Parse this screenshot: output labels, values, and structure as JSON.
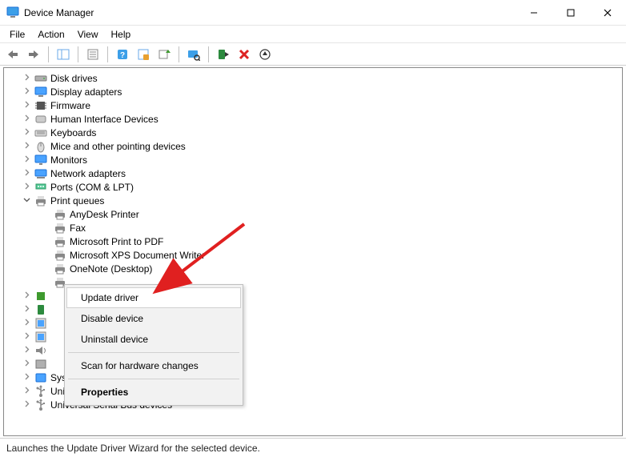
{
  "window": {
    "title": "Device Manager",
    "minimize": "–",
    "maximize": "□",
    "close": "✕"
  },
  "menu": {
    "file": "File",
    "action": "Action",
    "view": "View",
    "help": "Help"
  },
  "toolbar": {
    "back": "back",
    "forward": "forward",
    "show_hide": "show-hide",
    "properties": "properties",
    "help": "help",
    "refresh": "refresh",
    "uninstall": "uninstall",
    "update": "update",
    "scan": "scan",
    "disable": "disable",
    "remove": "remove",
    "more": "more"
  },
  "tree": {
    "items": [
      {
        "label": "Disk drives",
        "expanded": false,
        "icon": "disk"
      },
      {
        "label": "Display adapters",
        "expanded": false,
        "icon": "display"
      },
      {
        "label": "Firmware",
        "expanded": false,
        "icon": "chip"
      },
      {
        "label": "Human Interface Devices",
        "expanded": false,
        "icon": "hid"
      },
      {
        "label": "Keyboards",
        "expanded": false,
        "icon": "keyboard"
      },
      {
        "label": "Mice and other pointing devices",
        "expanded": false,
        "icon": "mouse"
      },
      {
        "label": "Monitors",
        "expanded": false,
        "icon": "monitor"
      },
      {
        "label": "Network adapters",
        "expanded": false,
        "icon": "network"
      },
      {
        "label": "Ports (COM & LPT)",
        "expanded": false,
        "icon": "port"
      },
      {
        "label": "Print queues",
        "expanded": true,
        "icon": "printer",
        "children": [
          {
            "label": "AnyDesk Printer"
          },
          {
            "label": "Fax"
          },
          {
            "label": "Microsoft Print to PDF"
          },
          {
            "label": "Microsoft XPS Document Writer"
          },
          {
            "label": "OneNote (Desktop)"
          },
          {
            "label": ""
          }
        ]
      },
      {
        "label": "",
        "expanded": false,
        "icon": "processor",
        "obscured": true
      },
      {
        "label": "",
        "expanded": false,
        "icon": "security",
        "obscured": true
      },
      {
        "label": "",
        "expanded": false,
        "icon": "software",
        "obscured": true
      },
      {
        "label": "",
        "expanded": false,
        "icon": "software",
        "obscured": true
      },
      {
        "label": "",
        "expanded": false,
        "icon": "sound",
        "obscured": true
      },
      {
        "label": "",
        "expanded": false,
        "icon": "storage",
        "obscured": true
      },
      {
        "label": "System devices",
        "expanded": false,
        "icon": "system",
        "partial": true
      },
      {
        "label": "Universal Serial Bus controllers",
        "expanded": false,
        "icon": "usb"
      },
      {
        "label": "Universal Serial Bus devices",
        "expanded": false,
        "icon": "usb"
      }
    ]
  },
  "context_menu": {
    "update_driver": "Update driver",
    "disable_device": "Disable device",
    "uninstall_device": "Uninstall device",
    "scan_changes": "Scan for hardware changes",
    "properties": "Properties"
  },
  "statusbar": {
    "text": "Launches the Update Driver Wizard for the selected device."
  }
}
